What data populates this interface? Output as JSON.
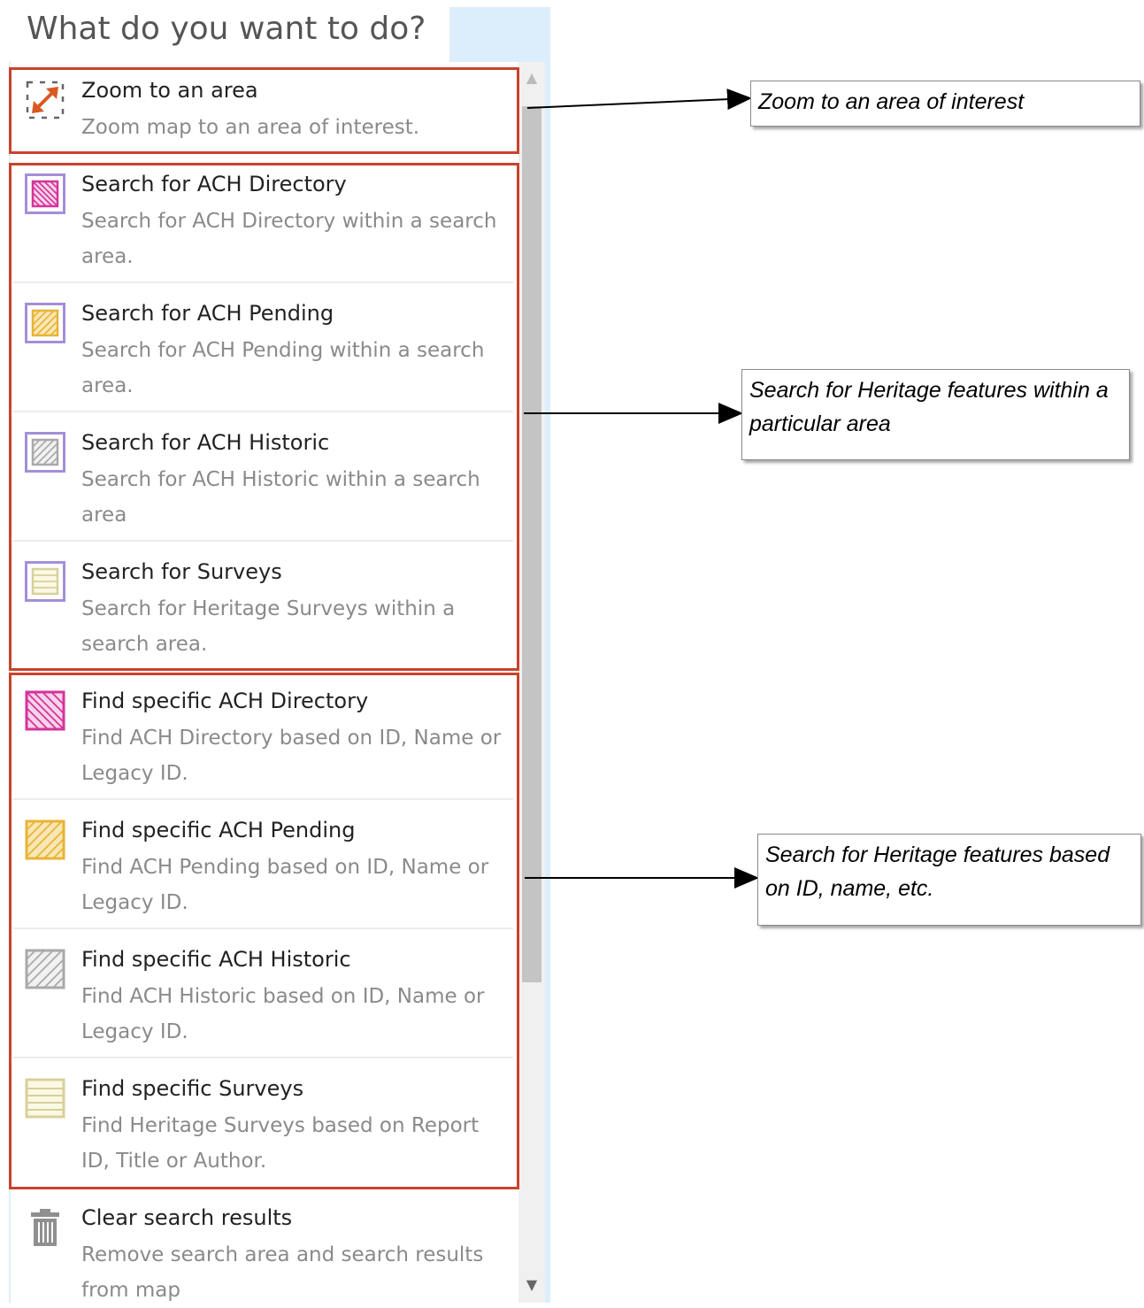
{
  "panel": {
    "title": "What do you want to do?"
  },
  "items": [
    {
      "label": "Zoom to an area",
      "description": "Zoom map to an area of interest.",
      "icon": "zoom-area-icon"
    },
    {
      "label": "Search for ACH Directory",
      "description": "Search for ACH Directory within a search area.",
      "icon": "ach-directory-area-icon"
    },
    {
      "label": "Search for ACH Pending",
      "description": "Search for ACH Pending within a search area.",
      "icon": "ach-pending-area-icon"
    },
    {
      "label": "Search for ACH Historic",
      "description": "Search for ACH Historic within a search area",
      "icon": "ach-historic-area-icon"
    },
    {
      "label": "Search for Surveys",
      "description": "Search for Heritage Surveys within a search area.",
      "icon": "surveys-area-icon"
    },
    {
      "label": "Find specific ACH Directory",
      "description": "Find ACH Directory based on ID, Name or Legacy ID.",
      "icon": "ach-directory-icon"
    },
    {
      "label": "Find specific ACH Pending",
      "description": "Find ACH Pending based on ID, Name or Legacy ID.",
      "icon": "ach-pending-icon"
    },
    {
      "label": "Find specific ACH Historic",
      "description": "Find ACH Historic based on ID, Name or Legacy ID.",
      "icon": "ach-historic-icon"
    },
    {
      "label": "Find specific Surveys",
      "description": "Find Heritage Surveys based on Report ID, Title or Author.",
      "icon": "surveys-icon"
    },
    {
      "label": "Clear search results",
      "description": "Remove search area and search results from map",
      "icon": "trash-icon"
    }
  ],
  "callouts": {
    "zoom": "Zoom to an area of interest",
    "area_search": "Search for Heritage features within a particular area",
    "attribute_search": "Search for Heritage features based on ID, name, etc."
  },
  "colors": {
    "highlight": "#c8432b",
    "directory": "#d6339a",
    "pending": "#e8b436",
    "historic": "#a9a9a9",
    "surveys": "#d8d09a",
    "area_frame": "#a48fd8",
    "zoom_arrow": "#d85a22"
  }
}
